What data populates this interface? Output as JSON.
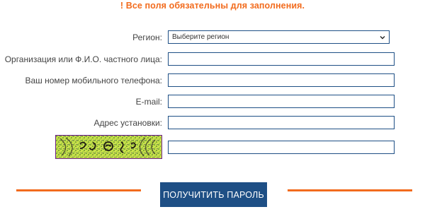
{
  "notice": "! Все поля обязательны для заполнения.",
  "form": {
    "region": {
      "label": "Регион:",
      "selected": "Выберите регион"
    },
    "organization": {
      "label": "Организация или Ф.И.О. частного лица:",
      "value": ""
    },
    "phone": {
      "label": "Ваш номер мобильного телефона:",
      "value": ""
    },
    "email": {
      "label": "E-mail:",
      "value": ""
    },
    "address": {
      "label": "Адрес установки:",
      "value": ""
    },
    "captcha": {
      "value": ""
    }
  },
  "submit_label": "ПОЛУЧИТИТЬ ПАРОЛЬ",
  "colors": {
    "accent_orange": "#f26b1d",
    "primary_blue": "#1e4f85",
    "captcha_border": "#6c1e8a",
    "captcha_bg": "#c9e24a"
  },
  "icons": {
    "select_arrow": "chevron-down-icon"
  }
}
